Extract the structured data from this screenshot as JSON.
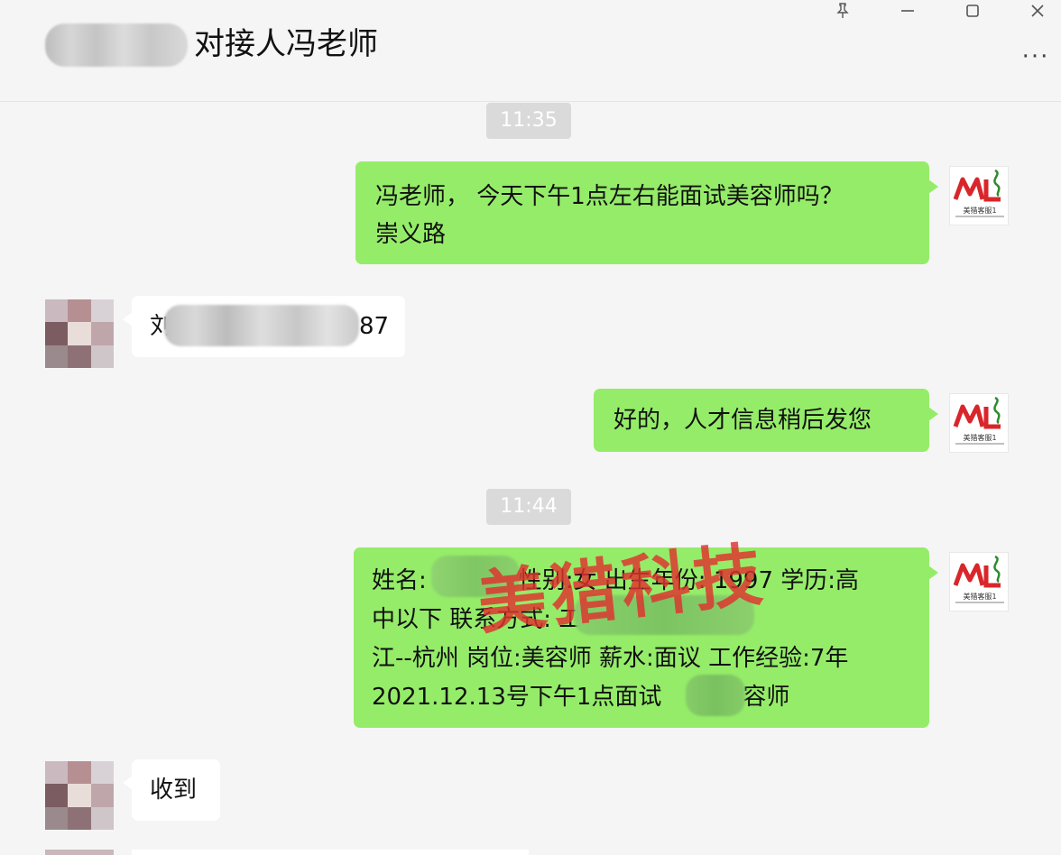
{
  "header": {
    "chat_title": "对接人冯老师",
    "more_label": "···"
  },
  "window_controls": {
    "pin_icon": "pin-icon",
    "minimize_icon": "minimize-icon",
    "maximize_icon": "maximize-icon",
    "close_icon": "close-icon"
  },
  "messages": {
    "time1": "11:35",
    "m1_line1": "冯老师， 今天下午1点左右能面试美容师吗？",
    "m1_line2": "崇义路",
    "m2_prefix": "刘",
    "m2_suffix": "87",
    "m3": "好的，人才信息稍后发您",
    "time2": "11:44",
    "m4_l1a": "姓名:",
    "m4_l1b": "性别:女 出生年份: 1997 学历:高",
    "m4_l2": "中以下 联系方式:            工作地点:浙",
    "m4_l3": "江--杭州 岗位:美容师 薪水:面议 工作经验:7年",
    "m4_l4a": " 2021.12.13号下午1点面试",
    "m4_l4b": "美容师",
    "m5": "收到"
  },
  "logo": {
    "brand_text": "美猎客服1",
    "brand_color": "#d8262b",
    "accent_color": "#2e8b2e"
  },
  "watermark": "美猎科技",
  "colors": {
    "sent_bubble": "#95ec69",
    "received_bubble": "#ffffff",
    "background": "#f5f5f5",
    "time_badge": "#dadada"
  }
}
